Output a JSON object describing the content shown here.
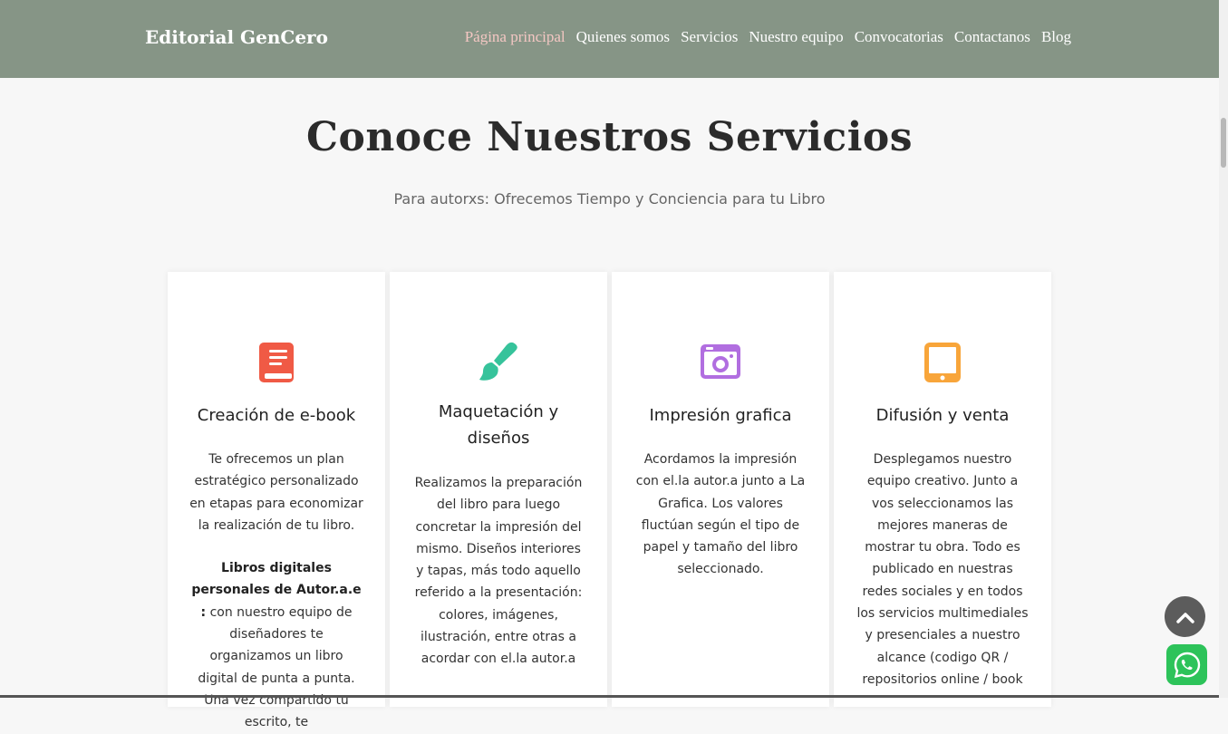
{
  "header": {
    "brand": "Editorial GenCero",
    "nav": [
      "Página principal",
      "Quienes somos",
      "Servicios",
      "Nuestro equipo",
      "Convocatorias",
      "Contactanos",
      "Blog"
    ],
    "active_color": "#f4c7c3",
    "bg_color": "#869586"
  },
  "section": {
    "title": "Conoce Nuestros Servicios",
    "subtitle": "Para autorxs: Ofrecemos Tiempo y Conciencia para tu Libro"
  },
  "cards": [
    {
      "icon": "book-icon",
      "icon_color": "#f05a45",
      "title": "Creación de e-book",
      "text": "Te ofrecemos un plan estratégico personalizado en etapas para economizar la realización de tu libro.",
      "bold": "Libros digitales personales de Autor.a.e :",
      "text2": " con nuestro equipo de diseñadores te organizamos un libro digital de punta a punta. Una vez compartido tu escrito, te"
    },
    {
      "icon": "paintbrush-icon",
      "icon_color": "#36c39b",
      "title": "Maquetación y diseños",
      "text": "Realizamos la preparación del libro para luego concretar la impresión del mismo. Diseños interiores y tapas, más todo aquello referido a la presentación: colores, imágenes, ilustración, entre otras a acordar con el.la autor.a"
    },
    {
      "icon": "camera-icon",
      "icon_color": "#b16ee0",
      "title": "Impresión grafica",
      "text": "Acordamos la impresión con el.la autor.a junto a La Grafica. Los valores fluctúan según el tipo de papel y tamaño del libro seleccionado."
    },
    {
      "icon": "tablet-icon",
      "icon_color": "#f8a53a",
      "title": "Difusión y venta",
      "text": "Desplegamos nuestro equipo creativo. Junto a vos seleccionamos las mejores maneras de mostrar tu obra. Todo es publicado en nuestras redes sociales y en todos los servicios multimediales y presenciales a nuestro alcance (codigo QR / repositorios online / book"
    }
  ],
  "floating": {
    "scroll_top_icon": "chevron-up-icon",
    "whatsapp_icon": "whatsapp-icon",
    "whatsapp_color": "#2dc35a"
  }
}
